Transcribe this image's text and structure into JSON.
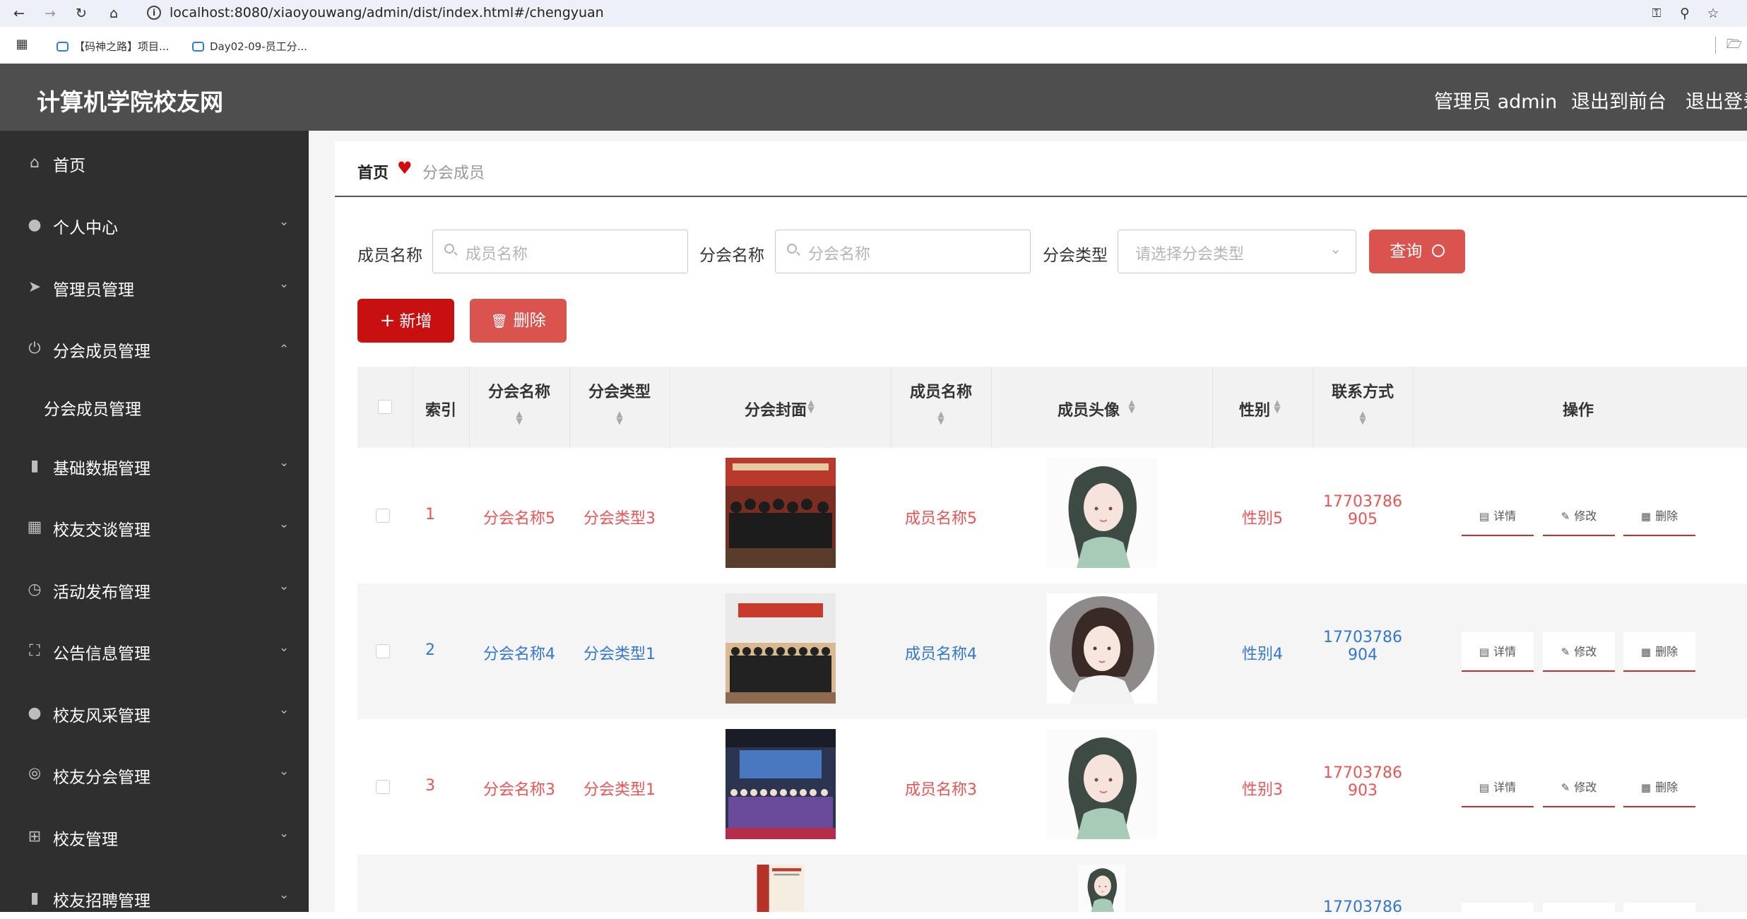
{
  "browser": {
    "url": "localhost:8080/xiaoyouwang/admin/dist/index.html#/chengyuan",
    "bookmarks": [
      "【码神之路】项目...",
      "Day02-09-员工分..."
    ]
  },
  "header": {
    "title": "计算机学院校友网",
    "admin_label": "管理员 admin",
    "front_link": "退出到前台",
    "logout_link": "退出登录"
  },
  "sidebar": {
    "items": [
      {
        "label": "首页",
        "icon": "home-icon"
      },
      {
        "label": "个人中心",
        "icon": "user-icon"
      },
      {
        "label": "管理员管理",
        "icon": "send-icon"
      },
      {
        "label": "分会成员管理",
        "icon": "power-icon"
      },
      {
        "label": "分会成员管理",
        "icon": ""
      },
      {
        "label": "基础数据管理",
        "icon": "tag-icon"
      },
      {
        "label": "校友交谈管理",
        "icon": "grid-icon"
      },
      {
        "label": "活动发布管理",
        "icon": "clock-icon"
      },
      {
        "label": "公告信息管理",
        "icon": "fullscreen-icon"
      },
      {
        "label": "校友风采管理",
        "icon": "user-icon"
      },
      {
        "label": "校友分会管理",
        "icon": "compass-icon"
      },
      {
        "label": "校友管理",
        "icon": "crop-icon"
      },
      {
        "label": "校友招聘管理",
        "icon": "briefcase-icon"
      }
    ]
  },
  "breadcrumb": {
    "home": "首页",
    "current": "分会成员"
  },
  "filters": {
    "member_label": "成员名称",
    "member_placeholder": "成员名称",
    "branch_label": "分会名称",
    "branch_placeholder": "分会名称",
    "type_label": "分会类型",
    "type_placeholder": "请选择分会类型",
    "query_button": "查询"
  },
  "actions": {
    "add_button": "新增",
    "delete_button": "删除"
  },
  "table": {
    "columns": [
      "索引",
      "分会名称",
      "分会类型",
      "分会封面",
      "成员名称",
      "成员头像",
      "性别",
      "联系方式",
      "操作"
    ],
    "row_actions": {
      "detail": "详情",
      "edit": "修改",
      "delete": "删除"
    },
    "rows": [
      {
        "index": "1",
        "branch": "分会名称5",
        "type": "分会类型3",
        "member": "成员名称5",
        "gender": "性别5",
        "phone1": "17703786",
        "phone2": "905",
        "color": "red"
      },
      {
        "index": "2",
        "branch": "分会名称4",
        "type": "分会类型1",
        "member": "成员名称4",
        "gender": "性别4",
        "phone1": "17703786",
        "phone2": "904",
        "color": "blue"
      },
      {
        "index": "3",
        "branch": "分会名称3",
        "type": "分会类型1",
        "member": "成员名称3",
        "gender": "性别3",
        "phone1": "17703786",
        "phone2": "903",
        "color": "red"
      },
      {
        "index": "",
        "branch": "",
        "type": "",
        "member": "",
        "gender": "",
        "phone1": "17703786",
        "phone2": "",
        "color": "blue"
      }
    ]
  },
  "colors": {
    "primary_red": "#c81010",
    "light_red": "#d9534f",
    "link_red": "#e75656",
    "link_blue": "#3377cc",
    "sidebar_bg": "#2f2f2f",
    "header_bg": "#4e4e4e"
  }
}
